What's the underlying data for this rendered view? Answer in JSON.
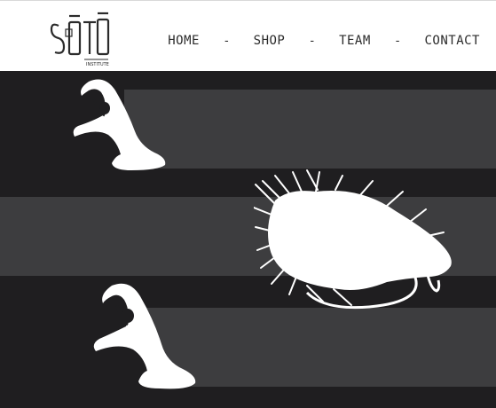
{
  "brand": {
    "name": "SŌTŌ",
    "tagline": "INSTITUTE"
  },
  "nav": {
    "items": [
      {
        "label": "HOME"
      },
      {
        "label": "SHOP"
      },
      {
        "label": "TEAM"
      },
      {
        "label": "CONTACT"
      }
    ],
    "separator": "-"
  },
  "colors": {
    "background": "#1f1e20",
    "stripe": "#3d3d3f",
    "header": "#ffffff",
    "text": "#2b2b2b",
    "art": "#ffffff"
  },
  "hero": {
    "icons": [
      "hook-eye-icon",
      "fishing-fly-icon",
      "hook-eye-icon"
    ]
  }
}
